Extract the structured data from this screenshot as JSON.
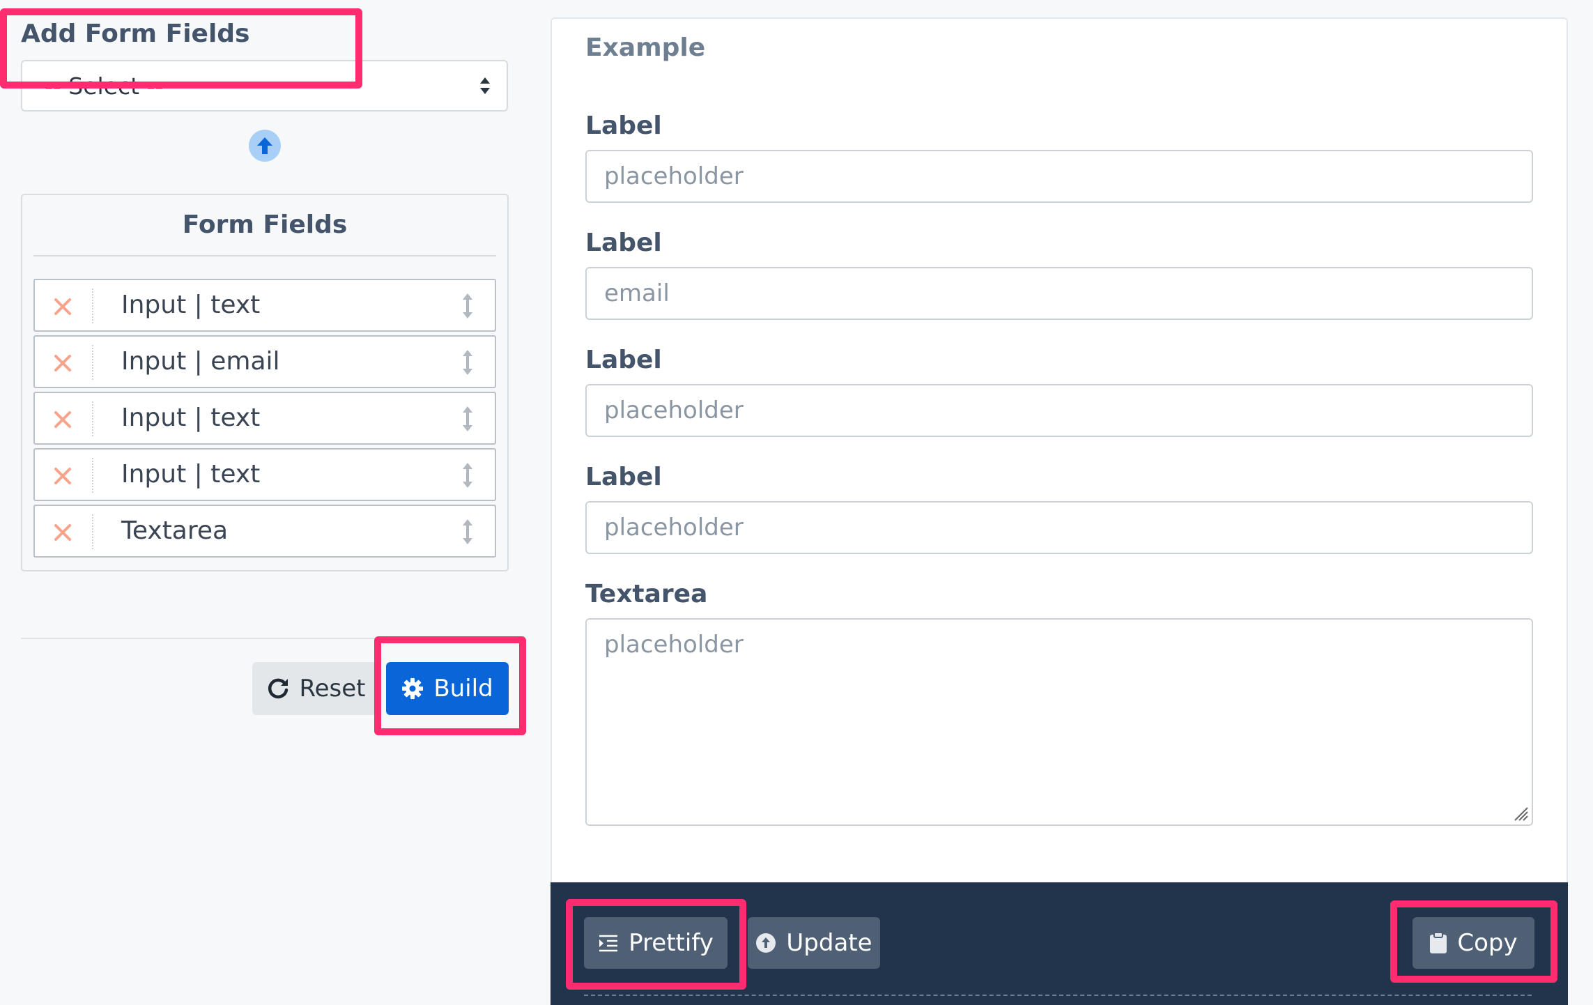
{
  "add_fields": {
    "title": "Add Form Fields",
    "select_value": "-- Select --"
  },
  "form_fields": {
    "title": "Form Fields",
    "items": [
      {
        "label": "Input | text"
      },
      {
        "label": "Input | email"
      },
      {
        "label": "Input | text"
      },
      {
        "label": "Input | text"
      },
      {
        "label": "Textarea"
      }
    ]
  },
  "actions": {
    "reset_label": "Reset",
    "build_label": "Build"
  },
  "preview": {
    "title": "Example",
    "fields": [
      {
        "label": "Label",
        "placeholder": "placeholder"
      },
      {
        "label": "Label",
        "placeholder": "email"
      },
      {
        "label": "Label",
        "placeholder": "placeholder"
      },
      {
        "label": "Label",
        "placeholder": "placeholder"
      }
    ],
    "textarea": {
      "label": "Textarea",
      "placeholder": "placeholder"
    }
  },
  "code_toolbar": {
    "prettify_label": "Prettify",
    "update_label": "Update",
    "copy_label": "Copy"
  },
  "colors": {
    "highlight": "#ff2d6f",
    "primary": "#0a66d8",
    "code_bg": "#22344c",
    "delete_icon": "#f7a48a"
  },
  "icons": {
    "select": "sort-arrows-icon",
    "move_up": "arrow-up-circle-icon",
    "delete": "x-icon",
    "drag": "vertical-resize-icon",
    "reset": "redo-icon",
    "build": "gear-icon",
    "prettify": "indent-icon",
    "update": "upload-circle-icon",
    "copy": "clipboard-icon"
  }
}
